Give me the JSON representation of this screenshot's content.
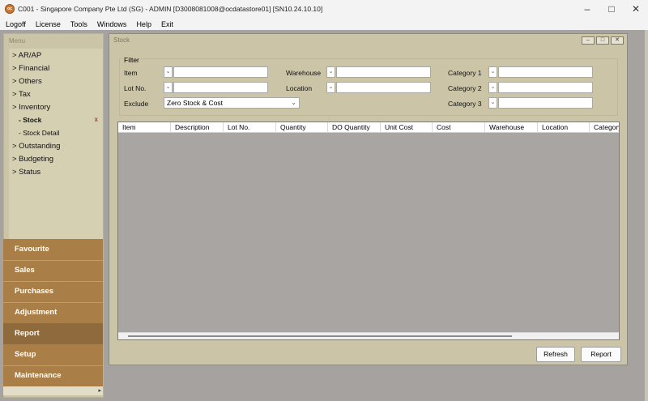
{
  "window": {
    "title": "C001 - Singapore Company Pte Ltd (SG) - ADMIN [D3008081008@ocdatastore01] [SN10.24.10.10]",
    "app_icon_text": "oc"
  },
  "menubar": [
    "Logoff",
    "License",
    "Tools",
    "Windows",
    "Help",
    "Exit"
  ],
  "sidebar": {
    "header": "Menu",
    "tree": [
      {
        "label": "> AR/AP"
      },
      {
        "label": "> Financial"
      },
      {
        "label": "> Others"
      },
      {
        "label": "> Tax"
      },
      {
        "label": "> Inventory"
      },
      {
        "label": "- Stock",
        "sub": true,
        "selected": true,
        "close_mark": "x"
      },
      {
        "label": "- Stock Detail",
        "sub": true
      },
      {
        "label": "> Outstanding"
      },
      {
        "label": "> Budgeting"
      },
      {
        "label": "> Status"
      }
    ],
    "bottom_menu": [
      "Favourite",
      "Sales",
      "Purchases",
      "Adjustment",
      "Report",
      "Setup",
      "Maintenance"
    ],
    "active_bottom": "Report"
  },
  "stock_window": {
    "title": "Stock",
    "filter": {
      "label": "Filter",
      "item_label": "Item",
      "lot_label": "Lot No.",
      "exclude_label": "Exclude",
      "exclude_value": "Zero Stock & Cost",
      "warehouse_label": "Warehouse",
      "location_label": "Location",
      "category1_label": "Category 1",
      "category2_label": "Category 2",
      "category3_label": "Category 3"
    },
    "grid_columns": [
      "Item",
      "Description",
      "Lot No.",
      "Quantity",
      "DO Quantity",
      "Unit Cost",
      "Cost",
      "Warehouse",
      "Location",
      "Category"
    ],
    "refresh_button": "Refresh",
    "report_button": "Report"
  }
}
